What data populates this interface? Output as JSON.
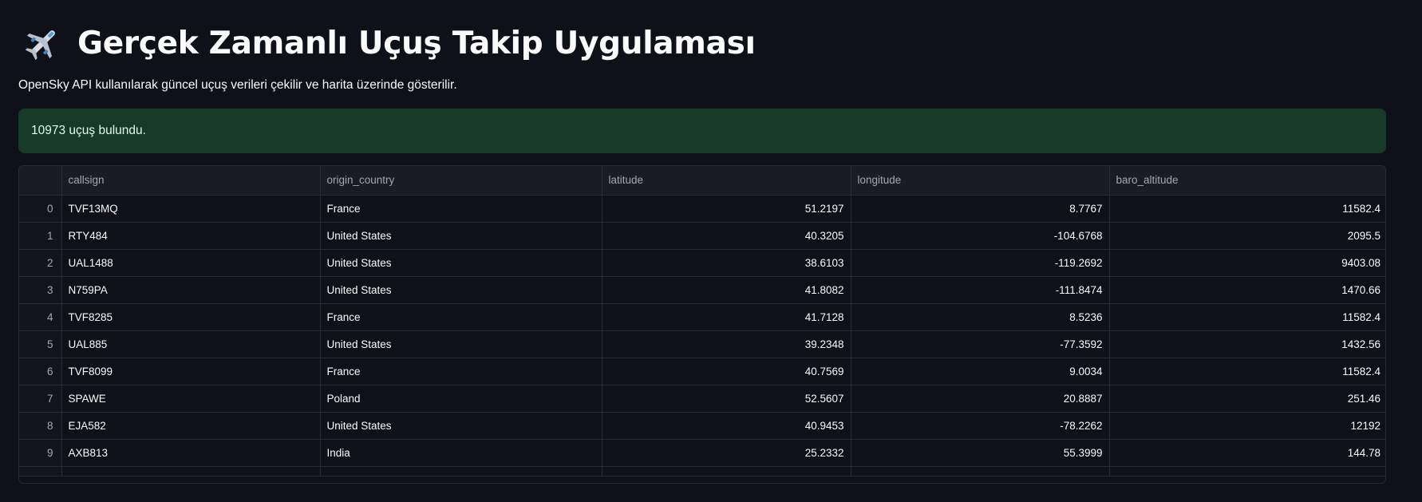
{
  "header": {
    "icon": "airplane-icon",
    "title": "Gerçek Zamanlı Uçuş Takip Uygulaması"
  },
  "subtitle": "OpenSky API kullanılarak güncel uçuş verileri çekilir ve harita üzerinde gösterilir.",
  "success_alert": {
    "text": "10973 uçuş bulundu.",
    "color": "#173928"
  },
  "table": {
    "columns": [
      "",
      "callsign",
      "origin_country",
      "latitude",
      "longitude",
      "baro_altitude"
    ],
    "rows": [
      [
        "0",
        "TVF13MQ",
        "France",
        "51.2197",
        "8.7767",
        "11582.4"
      ],
      [
        "1",
        "RTY484",
        "United States",
        "40.3205",
        "-104.6768",
        "2095.5"
      ],
      [
        "2",
        "UAL1488",
        "United States",
        "38.6103",
        "-119.2692",
        "9403.08"
      ],
      [
        "3",
        "N759PA",
        "United States",
        "41.8082",
        "-111.8474",
        "1470.66"
      ],
      [
        "4",
        "TVF8285",
        "France",
        "41.7128",
        "8.5236",
        "11582.4"
      ],
      [
        "5",
        "UAL885",
        "United States",
        "39.2348",
        "-77.3592",
        "1432.56"
      ],
      [
        "6",
        "TVF8099",
        "France",
        "40.7569",
        "9.0034",
        "11582.4"
      ],
      [
        "7",
        "SPAWE",
        "Poland",
        "52.5607",
        "20.8887",
        "251.46"
      ],
      [
        "8",
        "EJA582",
        "United States",
        "40.9453",
        "-78.2262",
        "12192"
      ],
      [
        "9",
        "AXB813",
        "India",
        "25.2332",
        "55.3999",
        "144.78"
      ]
    ]
  },
  "colors": {
    "background": "#0e1117",
    "text": "#fafafa",
    "muted": "#a3a8b4",
    "border": "#262a33"
  }
}
